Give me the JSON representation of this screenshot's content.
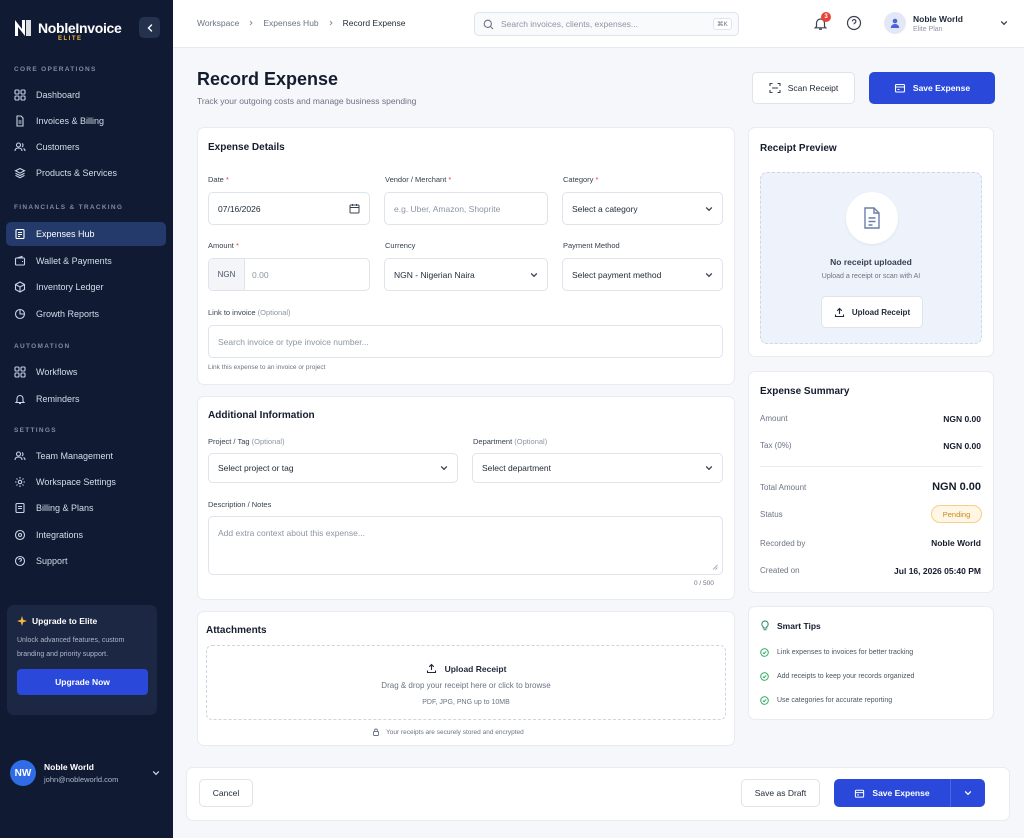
{
  "brand": {
    "name": "NobleInvoice",
    "tier": "ELITE"
  },
  "sidebar": {
    "sections": [
      {
        "label": "CORE OPERATIONS"
      },
      {
        "label": "FINANCIALS & TRACKING"
      },
      {
        "label": "AUTOMATION"
      },
      {
        "label": "SETTINGS"
      }
    ],
    "items": [
      {
        "label": "Dashboard",
        "icon": "grid-icon"
      },
      {
        "label": "Invoices & Billing",
        "icon": "document-icon"
      },
      {
        "label": "Customers",
        "icon": "users-icon"
      },
      {
        "label": "Products & Services",
        "icon": "layers-icon"
      },
      {
        "label": "Expenses Hub",
        "icon": "receipt-icon",
        "active": true
      },
      {
        "label": "Wallet & Payments",
        "icon": "wallet-icon"
      },
      {
        "label": "Inventory Ledger",
        "icon": "box-icon"
      },
      {
        "label": "Growth Reports",
        "icon": "chart-icon"
      },
      {
        "label": "Workflows",
        "icon": "workflow-icon"
      },
      {
        "label": "Reminders",
        "icon": "bell-icon"
      },
      {
        "label": "Team Management",
        "icon": "team-icon"
      },
      {
        "label": "Workspace Settings",
        "icon": "gear-icon"
      },
      {
        "label": "Billing & Plans",
        "icon": "card-icon"
      },
      {
        "label": "Integrations",
        "icon": "plug-icon"
      },
      {
        "label": "Support",
        "icon": "help-icon"
      }
    ],
    "upgrade": {
      "title": "Upgrade to Elite",
      "desc": "Unlock advanced features, custom branding and priority support.",
      "button": "Upgrade Now"
    },
    "user": {
      "initials": "NW",
      "name": "Noble World",
      "email": "john@nobleworld.com"
    }
  },
  "topbar": {
    "breadcrumb": [
      "Workspace",
      "Expenses Hub",
      "Record Expense"
    ],
    "search_placeholder": "Search invoices, clients, expenses...",
    "search_shortcut": "⌘K",
    "notifications": "3",
    "user": {
      "name": "Noble World",
      "plan": "Elite Plan"
    }
  },
  "header": {
    "title": "Record Expense",
    "subtitle": "Track your outgoing costs and manage business spending",
    "scan_label": "Scan Receipt",
    "save_label": "Save Expense"
  },
  "details": {
    "title": "Expense Details",
    "date_label": "Date",
    "date_value": "07/16/2026",
    "vendor_label": "Vendor / Merchant",
    "vendor_placeholder": "e.g. Uber, Amazon, Shoprite",
    "category_label": "Category",
    "category_placeholder": "Select a category",
    "amount_label": "Amount",
    "amount_prefix": "NGN",
    "amount_placeholder": "0.00",
    "currency_label": "Currency",
    "currency_value": "NGN - Nigerian Naira",
    "payment_label": "Payment Method",
    "payment_placeholder": "Select payment method",
    "link_label": "Link to invoice",
    "link_optional": "(Optional)",
    "link_placeholder": "Search invoice or type invoice number...",
    "link_hint": "Link this expense to an invoice or project"
  },
  "additional": {
    "title": "Additional Information",
    "project_label": "Project / Tag",
    "project_optional": "(Optional)",
    "project_placeholder": "Select project or tag",
    "department_label": "Department",
    "department_optional": "(Optional)",
    "department_placeholder": "Select department",
    "desc_label": "Description / Notes",
    "desc_placeholder": "Add extra context about this expense...",
    "desc_count": "0 / 500"
  },
  "attachments": {
    "title": "Attachments",
    "upload_label": "Upload Receipt",
    "drag_text": "Drag & drop your receipt here or click to browse",
    "formats": "PDF, JPG, PNG up to 10MB",
    "secure_note": "Your receipts are securely stored and encrypted"
  },
  "preview": {
    "title": "Receipt Preview",
    "empty_title": "No receipt uploaded",
    "empty_desc": "Upload a receipt or scan with AI",
    "upload_label": "Upload Receipt"
  },
  "summary": {
    "title": "Expense Summary",
    "amount_label": "Amount",
    "amount_value": "NGN 0.00",
    "tax_label": "Tax (0%)",
    "tax_value": "NGN 0.00",
    "total_label": "Total Amount",
    "total_value": "NGN 0.00",
    "status_label": "Status",
    "status_value": "Pending",
    "recorded_label": "Recorded by",
    "recorded_value": "Noble World",
    "created_label": "Created on",
    "created_value": "Jul 16, 2026 05:40 PM"
  },
  "tips": {
    "title": "Smart Tips",
    "items": [
      "Link expenses to invoices for better tracking",
      "Add receipts to keep your records organized",
      "Use categories for accurate reporting"
    ]
  },
  "footer": {
    "cancel": "Cancel",
    "draft": "Save as Draft",
    "save": "Save Expense"
  },
  "colors": {
    "sidebar": "#101b33",
    "accent": "#2a49db",
    "active": "#243a6b",
    "pending": "#f4b63c",
    "success": "#22a355"
  }
}
